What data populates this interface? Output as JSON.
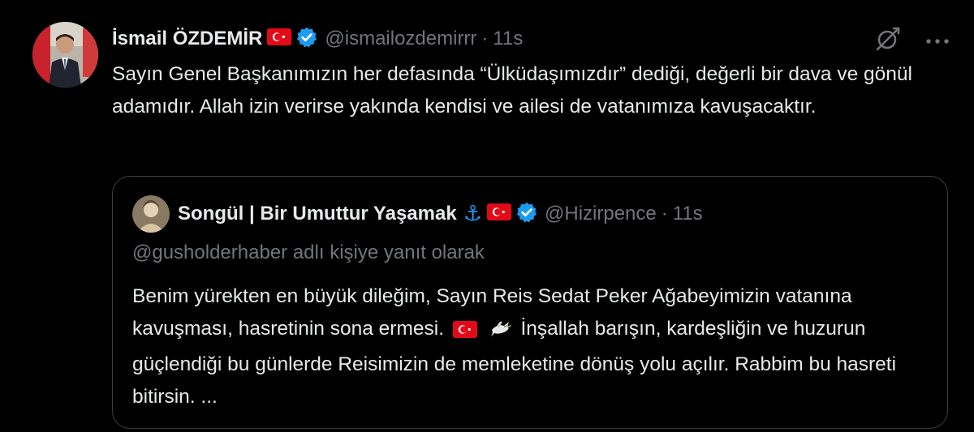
{
  "tweet": {
    "author_name": "İsmail ÖZDEMİR",
    "handle": "@ismailozdemirrr",
    "separator": "·",
    "time": "11s",
    "text": "Sayın Genel Başkanımızın her defasında “Ülküdaşımızdır” dediği, değerli bir dava ve gönül adamıdır. Allah izin verirse yakında kendisi ve ailesi de vatanımıza kavuşacaktır."
  },
  "quote": {
    "author_name": "Songül | Bir Umuttur Yaşamak",
    "anchor_emoji": "⚓",
    "handle": "@Hizirpence",
    "separator": "·",
    "time": "11s",
    "reply_to": "@gusholderhaber adlı kişiye yanıt olarak",
    "text_part1": "Benim yürekten en büyük dileğim, Sayın Reis Sedat Peker Ağabeyimizin vatanına kavuşması, hasretinin sona ermesi.",
    "text_part2": "İnşallah barışın, kardeşliğin ve huzurun güçlendiği bu günlerde Reisimizin de memleketine dönüş yolu açılır. Rabbim bu hasreti bitirsin.  ..."
  },
  "colors": {
    "background": "#000000",
    "text": "#e7e9ea",
    "muted": "#71767b",
    "verified": "#1d9bf0",
    "flag_red": "#e30a17"
  }
}
